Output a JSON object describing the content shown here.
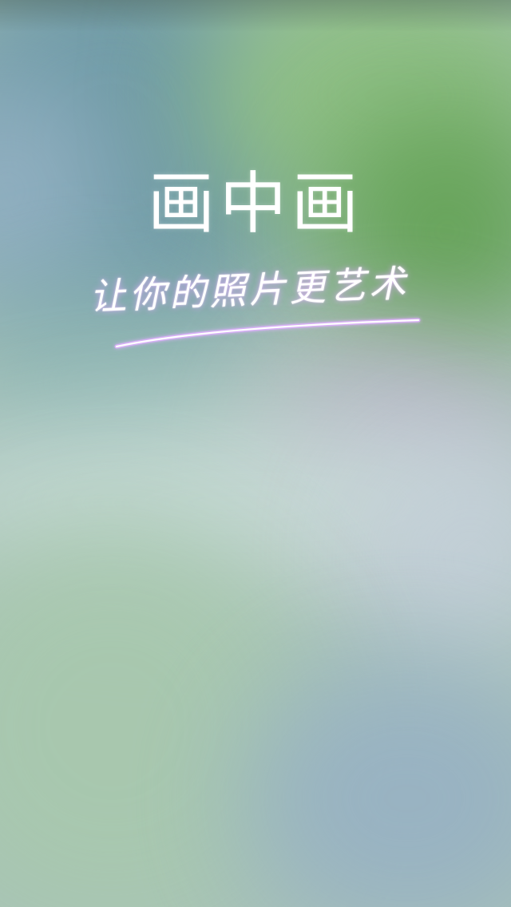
{
  "splash": {
    "app_title": "画中画",
    "tagline": "让你的照片更艺术"
  },
  "colors": {
    "text": "#ffffff",
    "glow": "#e0b0ff"
  }
}
